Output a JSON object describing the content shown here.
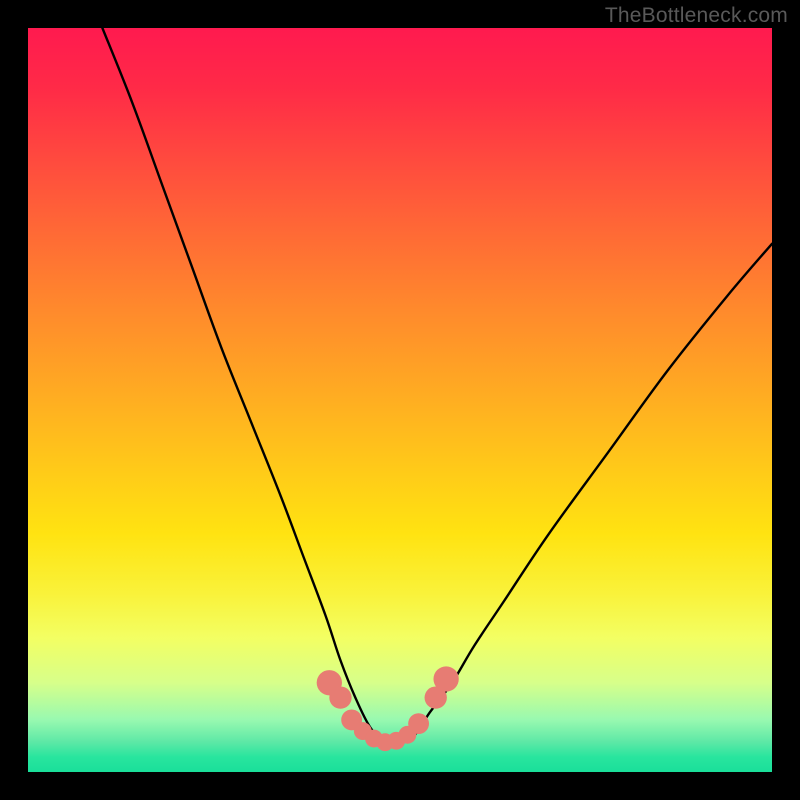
{
  "attribution": "TheBottleneck.com",
  "chart_data": {
    "type": "line",
    "title": "",
    "xlabel": "",
    "ylabel": "",
    "xlim": [
      0,
      100
    ],
    "ylim": [
      0,
      100
    ],
    "grid": false,
    "legend": false,
    "note": "Axes have no visible tick labels; x/y are normalized 0–100 of the plot area. y is bottleneck percentage (0 = bottom/green, 100 = top/red). Curve is a V-shaped bottleneck curve with minimum near x≈47.",
    "series": [
      {
        "name": "bottleneck-curve",
        "color": "#000000",
        "x": [
          10,
          14,
          18,
          22,
          26,
          30,
          34,
          37,
          40,
          42,
          44,
          46,
          48,
          50,
          52,
          54,
          57,
          60,
          64,
          70,
          78,
          86,
          94,
          100
        ],
        "y": [
          100,
          90,
          79,
          68,
          57,
          47,
          37,
          29,
          21,
          15,
          10,
          6,
          4,
          4,
          5,
          8,
          12,
          17,
          23,
          32,
          43,
          54,
          64,
          71
        ]
      }
    ],
    "markers": {
      "name": "highlight-dots",
      "color": "#e77c73",
      "x": [
        40.5,
        42.0,
        43.5,
        45.0,
        46.5,
        48.0,
        49.5,
        51.0,
        52.5,
        54.8,
        56.2
      ],
      "y": [
        12.0,
        10.0,
        7.0,
        5.5,
        4.5,
        4.0,
        4.2,
        5.0,
        6.5,
        10.0,
        12.5
      ],
      "r": [
        1.7,
        1.5,
        1.4,
        1.2,
        1.2,
        1.2,
        1.2,
        1.2,
        1.4,
        1.5,
        1.7
      ]
    }
  }
}
